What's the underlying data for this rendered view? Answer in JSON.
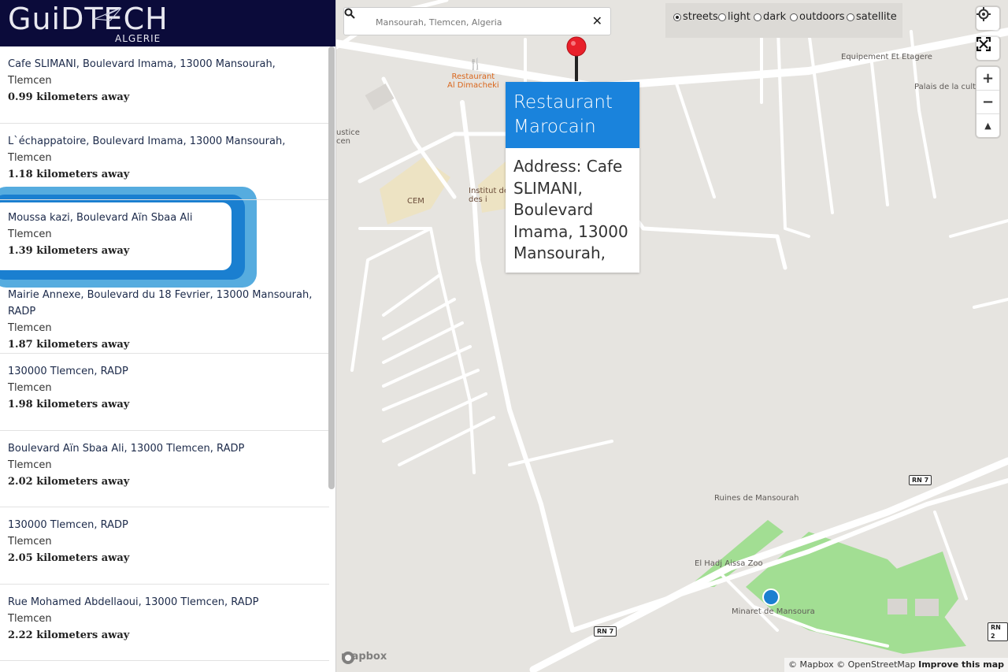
{
  "logo": {
    "text": "GuiDTECH",
    "subtitle": "ALGERIE"
  },
  "results": [
    {
      "address": "Cafe SLIMANI, Boulevard Imama, 13000 Mansourah,",
      "city": "Tlemcen",
      "distance": "0.99 kilometers away"
    },
    {
      "address": "L`échappatoire, Boulevard Imama, 13000 Mansourah,",
      "city": "Tlemcen",
      "distance": "1.18 kilometers away"
    },
    {
      "address": "Moussa kazi, Boulevard Aïn Sbaa Ali",
      "city": "Tlemcen",
      "distance": "1.39 kilometers away"
    },
    {
      "address": "Mairie Annexe, Boulevard du 18 Fevrier, 13000 Mansourah, RADP",
      "city": "Tlemcen",
      "distance": "1.87 kilometers away"
    },
    {
      "address": "130000 Tlemcen, RADP",
      "city": "Tlemcen",
      "distance": "1.98 kilometers away"
    },
    {
      "address": "Boulevard Aïn Sbaa Ali, 13000 Tlemcen, RADP",
      "city": "Tlemcen",
      "distance": "2.02 kilometers away"
    },
    {
      "address": "130000 Tlemcen, RADP",
      "city": "Tlemcen",
      "distance": "2.05 kilometers away"
    },
    {
      "address": "Rue Mohamed Abdellaoui, 13000 Tlemcen, RADP",
      "city": "Tlemcen",
      "distance": "2.22 kilometers away"
    }
  ],
  "search": {
    "value": "Mansourah, Tlemcen, Algeria",
    "clear": "✕"
  },
  "map_styles": {
    "selected": "streets",
    "options": [
      "streets",
      "light",
      "dark",
      "outdoors",
      "satellite"
    ]
  },
  "controls": {
    "zoom_in": "+",
    "zoom_out": "−",
    "compass": "▲"
  },
  "popup": {
    "title": "Restaurant Marocain",
    "body": "Address: Cafe SLIMANI, Boulevard Imama, 13000 Mansourah,"
  },
  "map_labels": {
    "restaurant": "Restaurant\nAl Dimacheki",
    "equipement": "Equipement Et Etagere",
    "palais": "Palais de la cultu",
    "justice": "ustice\ncen",
    "cem": "CEM",
    "institut": "Institut de\ndes i",
    "ruines": "Ruines de Mansourah",
    "zoo": "El Hadj Aissa Zoo",
    "minaret": "Minaret de Mansoura",
    "rn7_a": "RN 7",
    "rn7_b": "RN 7",
    "rn2": "RN 2"
  },
  "attribution": {
    "mapbox": "© Mapbox",
    "osm": "© OpenStreetMap",
    "improve": "Improve this map"
  },
  "mapbox_logo": "mapbox",
  "colors": {
    "sidebar_header": "#0b0b3a",
    "popup_header": "#1a83dc",
    "selection": "#1a7fd0",
    "marker": "#e8202a",
    "location_dot": "#1a7fd0"
  }
}
